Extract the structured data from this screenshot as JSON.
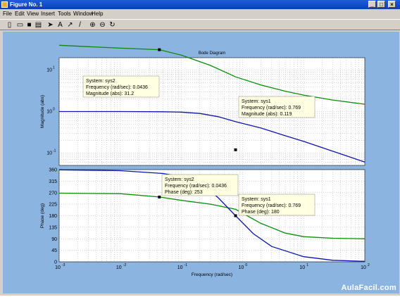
{
  "window": {
    "title": "Figure No. 1",
    "controls": [
      "_",
      "□",
      "×"
    ]
  },
  "menu": [
    "File",
    "Edit",
    "View",
    "Insert",
    "Tools",
    "Window",
    "Help"
  ],
  "toolbar_icons": [
    "new-file-icon",
    "open-folder-icon",
    "save-icon",
    "print-icon",
    "pointer-arrow-icon",
    "text-tool-icon",
    "arrow-tool-icon",
    "line-tool-icon",
    "zoom-in-icon",
    "zoom-out-icon",
    "rotate-icon"
  ],
  "toolbar_glyphs": [
    "▯",
    "▭",
    "■",
    "▤",
    "➤",
    "A",
    "↗",
    "/",
    "⊕",
    "⊖",
    "↻"
  ],
  "plot": {
    "title": "Bode Diagram",
    "xlabel": "Frequency  (rad/sec)"
  },
  "magnitude": {
    "ylabel": "Magnitude (abs)",
    "yticks": [
      {
        "base": "10",
        "exp": "1"
      },
      {
        "base": "10",
        "exp": "0"
      },
      {
        "base": "10",
        "exp": "-1"
      }
    ]
  },
  "phase": {
    "ylabel": "Phase (deg)",
    "yticks": [
      "360",
      "315",
      "270",
      "225",
      "180",
      "135",
      "90",
      "45",
      "0"
    ]
  },
  "xticks": [
    {
      "base": "10",
      "exp": "-3"
    },
    {
      "base": "10",
      "exp": "-2"
    },
    {
      "base": "10",
      "exp": "-1"
    },
    {
      "base": "10",
      "exp": "0"
    },
    {
      "base": "10",
      "exp": "1"
    },
    {
      "base": "10",
      "exp": "2"
    }
  ],
  "datatips": [
    {
      "lines": [
        "System: sys2",
        "Frequency (rad/sec): 0.0436",
        "Magnitude (abs): 31.2"
      ]
    },
    {
      "lines": [
        "System: sys1",
        "Frequency (rad/sec): 0.769",
        "Magnitude (abs): 0.119"
      ]
    },
    {
      "lines": [
        "System: sys2",
        "Frequency (rad/sec): 0.0436",
        "Phase (deg): 253"
      ]
    },
    {
      "lines": [
        "System: sys1",
        "Frequency (rad/sec): 0.769",
        "Phase (deg): 180"
      ]
    }
  ],
  "watermark": "AulaFacil.com",
  "chart_data": {
    "type": "line",
    "title": "Bode Diagram",
    "xlabel": "Frequency  (rad/sec)",
    "xscale": "log",
    "xlim": [
      0.001,
      100
    ],
    "panels": [
      {
        "ylabel": "Magnitude (abs)",
        "yscale": "log",
        "ylim": [
          0.05,
          20
        ],
        "series": [
          {
            "color": "#0a8a0a",
            "x": [
              0.001,
              0.003,
              0.01,
              0.0436,
              0.1,
              0.3,
              0.769,
              2,
              5,
              10,
              30,
              100
            ],
            "y": [
              40,
              37,
              34,
              31.2,
              23,
              13,
              6.9,
              4.4,
              3.1,
              2.5,
              1.9,
              1.5
            ]
          },
          {
            "color": "#0a16a8",
            "x": [
              0.001,
              0.01,
              0.05,
              0.1,
              0.2,
              0.4,
              0.769,
              2,
              5,
              10,
              30,
              100
            ],
            "y": [
              1,
              1,
              0.99,
              0.97,
              0.9,
              0.75,
              0.57,
              0.4,
              0.26,
              0.19,
              0.11,
              0.06
            ]
          }
        ]
      },
      {
        "ylabel": "Phase (deg)",
        "ylim": [
          0,
          360
        ],
        "series": [
          {
            "color": "#0a8a0a",
            "x": [
              0.001,
              0.01,
              0.0436,
              0.1,
              0.3,
              0.769,
              2,
              5,
              10,
              30,
              100
            ],
            "y": [
              268,
              266,
              253,
              240,
              225,
              205,
              150,
              112,
              98,
              92,
              90
            ]
          },
          {
            "color": "#0a16a8",
            "x": [
              0.001,
              0.01,
              0.05,
              0.1,
              0.2,
              0.4,
              0.769,
              1.5,
              3,
              10,
              30,
              100
            ],
            "y": [
              359,
              356,
              345,
              333,
              312,
              250,
              180,
              110,
              60,
              20,
              6,
              2
            ]
          }
        ]
      }
    ],
    "grid": true
  }
}
